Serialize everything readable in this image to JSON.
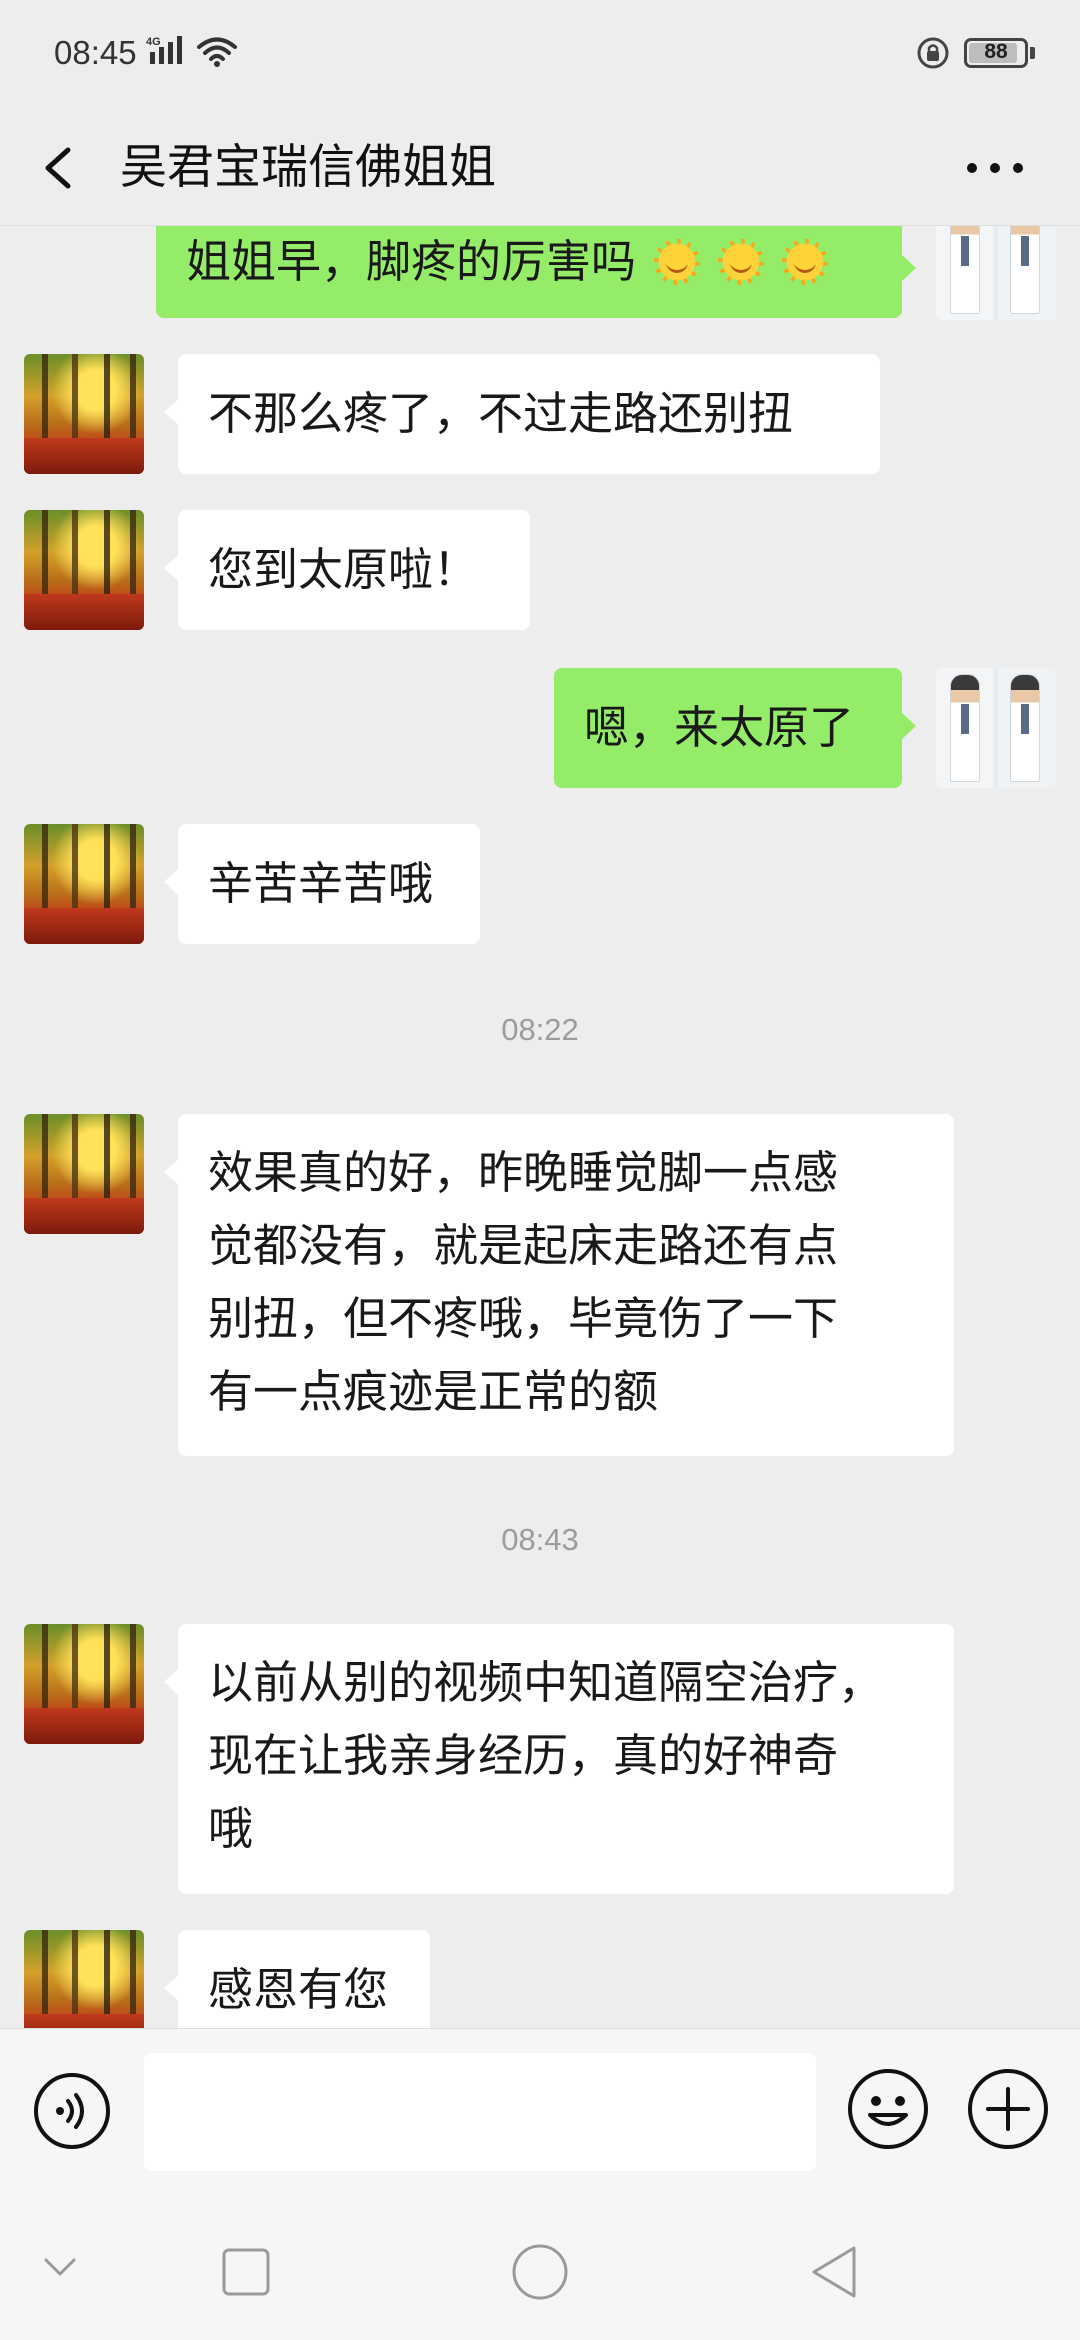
{
  "status_bar": {
    "time": "08:45",
    "network": "4G",
    "battery": "88",
    "battery_percent": 88
  },
  "header": {
    "title": "吴君宝瑞信佛姐姐",
    "back_icon": "back-arrow-icon",
    "more_icon": "more-dots-icon"
  },
  "messages": [
    {
      "side": "out",
      "text": "姐姐早，脚疼的厉害吗",
      "emoji": [
        "sun-emoji",
        "sun-emoji",
        "sun-emoji"
      ]
    },
    {
      "side": "in",
      "text": "不那么疼了，不过走路还别扭"
    },
    {
      "side": "in",
      "text": "您到太原啦！"
    },
    {
      "side": "out",
      "text": "嗯，来太原了"
    },
    {
      "side": "in",
      "text": "辛苦辛苦哦"
    },
    {
      "type": "timestamp",
      "text": "08:22"
    },
    {
      "side": "in",
      "lines": [
        "效果真的好，昨晚睡觉脚一点感",
        "觉都没有，就是起床走路还有点",
        "别扭，但不疼哦，毕竟伤了一下",
        "有一点痕迹是正常的额"
      ]
    },
    {
      "type": "timestamp",
      "text": "08:43"
    },
    {
      "side": "in",
      "lines": [
        "以前从别的视频中知道隔空治疗，",
        "现在让我亲身经历，真的好神奇",
        "哦"
      ]
    },
    {
      "side": "in",
      "text": "感恩有您"
    }
  ],
  "input_bar": {
    "value": "",
    "voice_icon": "voice-icon",
    "emoji_icon": "emoji-icon",
    "plus_icon": "plus-icon"
  },
  "nav_bar": {
    "icons": [
      "nav-collapse-icon",
      "recent-apps-icon",
      "home-icon",
      "back-triangle-icon"
    ]
  },
  "colors": {
    "background": "#ededed",
    "outgoing_bubble": "#95ec69",
    "incoming_bubble": "#ffffff",
    "timestamp_text": "#9c9c9c"
  }
}
